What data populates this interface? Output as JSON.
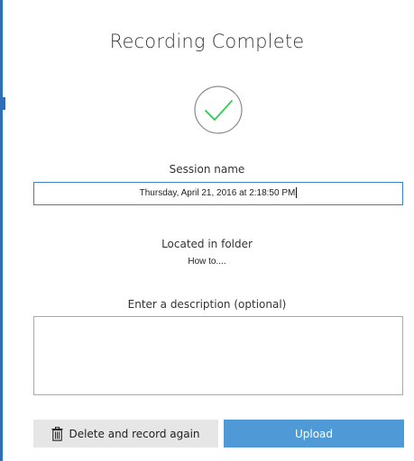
{
  "dialog": {
    "title": "Recording Complete",
    "session_label": "Session name",
    "session_value": "Thursday, April 21, 2016 at 2:18:50 PM",
    "folder_label": "Located in folder",
    "folder_value": "How to....",
    "description_label": "Enter a description (optional)",
    "description_value": ""
  },
  "buttons": {
    "delete_label": "Delete and record again",
    "upload_label": "Upload"
  },
  "icons": {
    "success": "check-circle-icon",
    "delete": "trash-icon"
  },
  "colors": {
    "accent": "#4f9ad6",
    "check": "#2ecc55",
    "input_focus_border": "#3b82c4",
    "secondary_button": "#e6e6e6"
  }
}
